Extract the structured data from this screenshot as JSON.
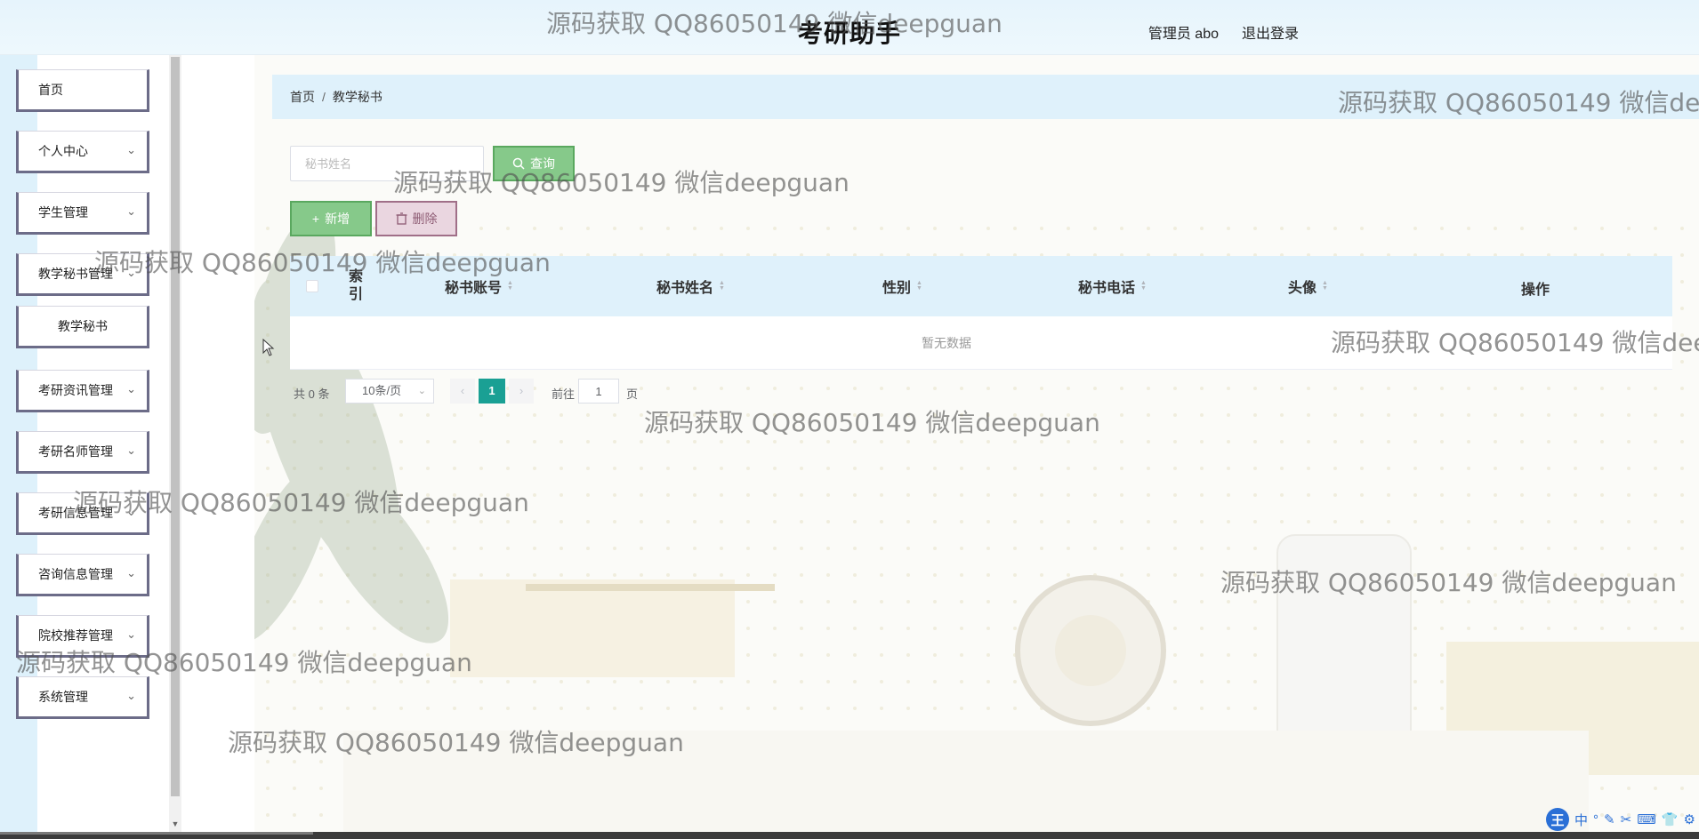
{
  "header": {
    "title": "考研助手",
    "admin": "管理员 abo",
    "logout": "退出登录"
  },
  "sidebar": {
    "items": [
      {
        "label": "首页",
        "expandable": false
      },
      {
        "label": "个人中心",
        "expandable": true
      },
      {
        "label": "学生管理",
        "expandable": true
      },
      {
        "label": "教学秘书管理",
        "expandable": true
      },
      {
        "label": "教学秘书",
        "expandable": false,
        "submenu": true
      },
      {
        "label": "考研资讯管理",
        "expandable": true
      },
      {
        "label": "考研名师管理",
        "expandable": true
      },
      {
        "label": "考研信息管理",
        "expandable": true
      },
      {
        "label": "咨询信息管理",
        "expandable": true
      },
      {
        "label": "院校推荐管理",
        "expandable": true
      },
      {
        "label": "系统管理",
        "expandable": true
      }
    ]
  },
  "breadcrumb": {
    "home": "首页",
    "separator": "/",
    "current": "教学秘书"
  },
  "search": {
    "placeholder": "秘书姓名",
    "button_label": "查询"
  },
  "actions": {
    "add_label": "新增",
    "delete_label": "删除"
  },
  "table": {
    "columns": [
      "索引",
      "秘书账号",
      "秘书姓名",
      "性别",
      "秘书电话",
      "头像",
      "操作"
    ],
    "empty_text": "暂无数据"
  },
  "pagination": {
    "total": "共 0 条",
    "page_size": "10条/页",
    "current_page": "1",
    "goto_label": "前往",
    "goto_value": "1",
    "page_unit": "页"
  },
  "watermark": "源码获取 QQ86050149 微信deepguan",
  "tray": [
    "中",
    "°",
    "✎",
    "✂",
    "⌨",
    "👕",
    "⚙"
  ],
  "tray_logo": "王",
  "colors": {
    "header_bg": "#e6f4fc",
    "accent_green": "#86c98a",
    "delete_pink": "#ead6e0",
    "page_active": "#1aa094",
    "table_header_bg": "#dff1fb"
  }
}
